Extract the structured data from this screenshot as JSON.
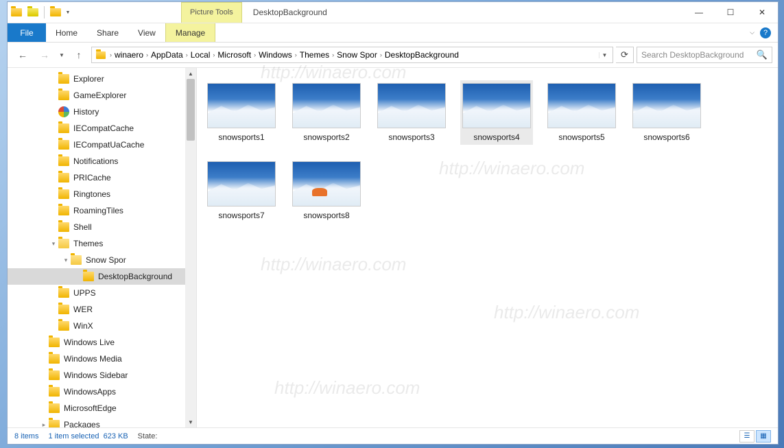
{
  "title": "DesktopBackground",
  "context_tab": {
    "group": "Picture Tools",
    "tab": "Manage"
  },
  "tabs": {
    "file": "File",
    "home": "Home",
    "share": "Share",
    "view": "View"
  },
  "breadcrumb": [
    "winaero",
    "AppData",
    "Local",
    "Microsoft",
    "Windows",
    "Themes",
    "Snow Spor",
    "DesktopBackground"
  ],
  "search_placeholder": "Search DesktopBackground",
  "tree": [
    {
      "label": "Explorer",
      "level": 1
    },
    {
      "label": "GameExplorer",
      "level": 1
    },
    {
      "label": "History",
      "level": 1,
      "icon": "history"
    },
    {
      "label": "IECompatCache",
      "level": 1
    },
    {
      "label": "IECompatUaCache",
      "level": 1
    },
    {
      "label": "Notifications",
      "level": 1
    },
    {
      "label": "PRICache",
      "level": 1
    },
    {
      "label": "Ringtones",
      "level": 1
    },
    {
      "label": "RoamingTiles",
      "level": 1
    },
    {
      "label": "Shell",
      "level": 1
    },
    {
      "label": "Themes",
      "level": 1,
      "open": true,
      "exp": "▾"
    },
    {
      "label": "Snow Spor",
      "level": 2,
      "open": true,
      "exp": "▾"
    },
    {
      "label": "DesktopBackground",
      "level": 3,
      "selected": true
    },
    {
      "label": "UPPS",
      "level": 1
    },
    {
      "label": "WER",
      "level": 1
    },
    {
      "label": "WinX",
      "level": 1
    },
    {
      "label": "Windows Live",
      "level": 0
    },
    {
      "label": "Windows Media",
      "level": 0
    },
    {
      "label": "Windows Sidebar",
      "level": 0
    },
    {
      "label": "WindowsApps",
      "level": 0
    },
    {
      "label": "MicrosoftEdge",
      "level": 0
    },
    {
      "label": "Packages",
      "level": 0,
      "exp": "▸"
    }
  ],
  "items": [
    {
      "name": "snowsports1"
    },
    {
      "name": "snowsports2"
    },
    {
      "name": "snowsports3"
    },
    {
      "name": "snowsports4",
      "near": true
    },
    {
      "name": "snowsports5"
    },
    {
      "name": "snowsports6"
    },
    {
      "name": "snowsports7"
    },
    {
      "name": "snowsports8",
      "orange": true
    }
  ],
  "status": {
    "count": "8 items",
    "selection": "1 item selected",
    "size": "623 KB",
    "state_label": "State:"
  },
  "watermark": "http://winaero.com"
}
